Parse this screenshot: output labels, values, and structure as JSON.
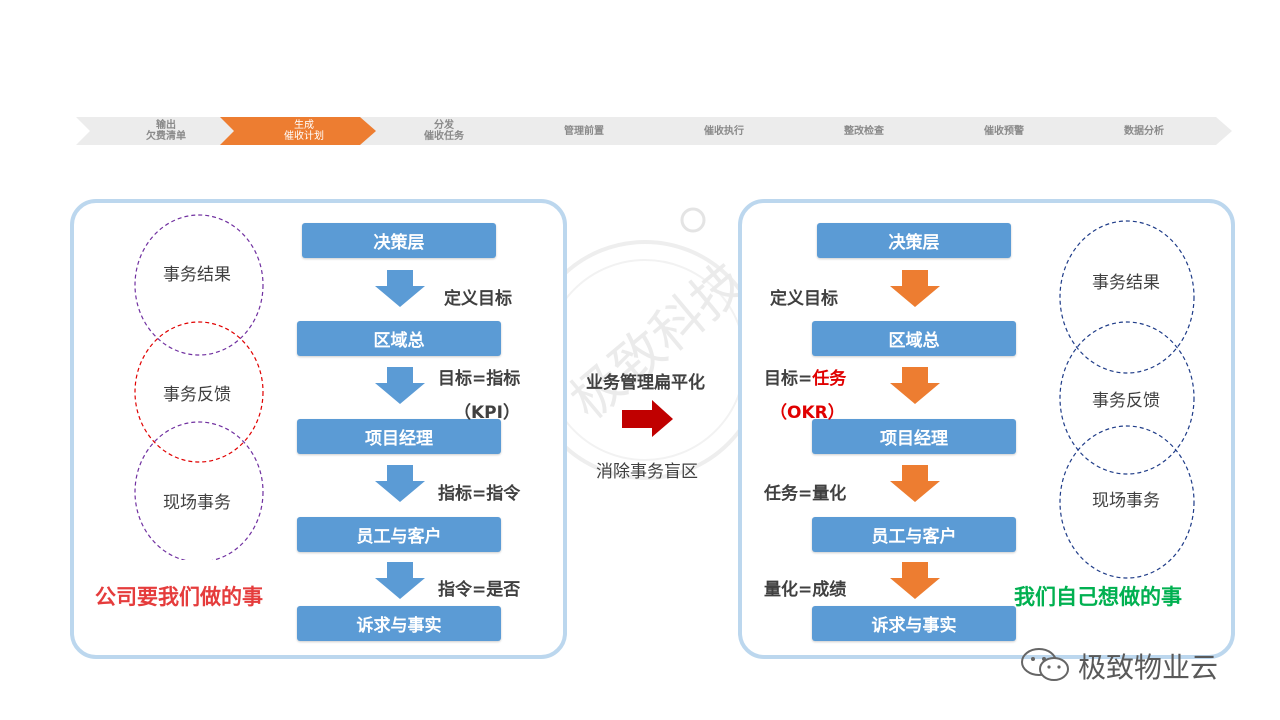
{
  "process_steps": [
    {
      "line1": "输出",
      "line2": "欠费清单"
    },
    {
      "line1": "生成",
      "line2": "催收计划"
    },
    {
      "line1": "分发",
      "line2": "催收任务"
    },
    {
      "line1": "管理前置",
      "line2": ""
    },
    {
      "line1": "催收执行",
      "line2": ""
    },
    {
      "line1": "整改检查",
      "line2": ""
    },
    {
      "line1": "催收预警",
      "line2": ""
    },
    {
      "line1": "数据分析",
      "line2": ""
    }
  ],
  "active_step_index": 1,
  "colors": {
    "active": "#ed7d31",
    "inactive": "#ececec",
    "box": "#5b9bd5",
    "panel_border": "#bcd7ee",
    "left_arrow": "#5b9bd5",
    "right_arrow": "#ed7d31",
    "center_arrow": "#c00000"
  },
  "left": {
    "boxes": [
      "决策层",
      "区域总",
      "项目经理",
      "员工与客户",
      "诉求与事实"
    ],
    "labels": {
      "l1": "定义目标",
      "l2a": "目标=指标",
      "l2b": "（KPI）",
      "l3": "指标=指令",
      "l4": "指令=是否"
    },
    "circles": [
      "事务结果",
      "事务反馈",
      "现场事务"
    ],
    "caption": "公司要我们做的事"
  },
  "center": {
    "top": "业务管理扁平化",
    "bottom": "消除事务盲区",
    "watermark": "极致科技"
  },
  "right": {
    "boxes": [
      "决策层",
      "区域总",
      "项目经理",
      "员工与客户",
      "诉求与事实"
    ],
    "labels": {
      "l1": "定义目标",
      "l2a_prefix": "目标=",
      "l2a_red": "任务",
      "l2b": "（OKR）",
      "l3": "任务=量化",
      "l4": "量化=成绩"
    },
    "circles": [
      "事务结果",
      "事务反馈",
      "现场事务"
    ],
    "caption": "我们自己想做的事"
  },
  "brand": "极致物业云"
}
